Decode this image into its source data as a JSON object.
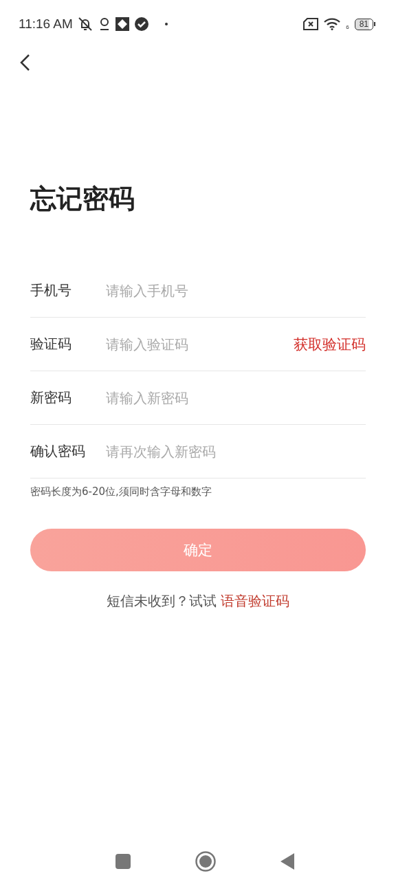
{
  "status_bar": {
    "time": "11:16 AM",
    "wifi_label": "6",
    "battery": "81"
  },
  "title": "忘记密码",
  "fields": [
    {
      "label": "手机号",
      "placeholder": "请输入手机号"
    },
    {
      "label": "验证码",
      "placeholder": "请输入验证码",
      "action": "获取验证码"
    },
    {
      "label": "新密码",
      "placeholder": "请输入新密码"
    },
    {
      "label": "确认密码",
      "placeholder": "请再次输入新密码"
    }
  ],
  "hint": "密码长度为6-20位,须同时含字母和数字",
  "submit": {
    "label": "确定",
    "disabled": true
  },
  "footer": {
    "text": "短信未收到？试试",
    "link": "语音验证码"
  }
}
